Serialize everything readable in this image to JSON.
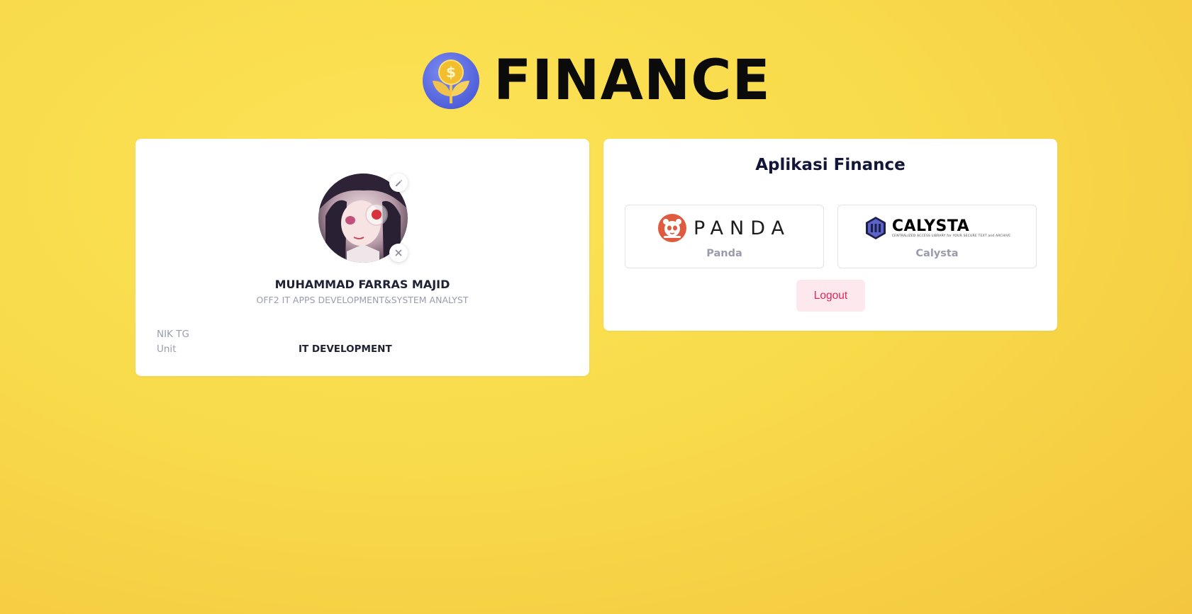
{
  "brand": {
    "title": "FINANCE",
    "logo_icon": "coin-plant-icon"
  },
  "profile": {
    "name": "MUHAMMAD FARRAS MAJID",
    "position": "OFF2 IT APPS DEVELOPMENT&SYSTEM ANALYST",
    "avatar_icon": "avatar",
    "edit_icon": "pencil-icon",
    "remove_icon": "close-icon",
    "fields": [
      {
        "label": "NIK TG",
        "value": ""
      },
      {
        "label": "Unit",
        "value": "IT DEVELOPMENT"
      }
    ]
  },
  "apps": {
    "title": "Aplikasi Finance",
    "items": [
      {
        "label": "Panda",
        "logo_text": "PANDA",
        "logo_color": "#e05a3f"
      },
      {
        "label": "Calysta",
        "logo_text": "CALYSTA",
        "logo_subtext": "CENTRALIZED ACCESS LIBRARY for YOUR SECURE TEXT and ARCHIVE",
        "logo_color": "#4b53a8"
      }
    ],
    "logout_label": "Logout"
  },
  "colors": {
    "background": "#f8db4a",
    "accent_logout": "#e0285a",
    "logout_bg": "#fde8ee",
    "brand_blue": "#5a6fe0"
  }
}
